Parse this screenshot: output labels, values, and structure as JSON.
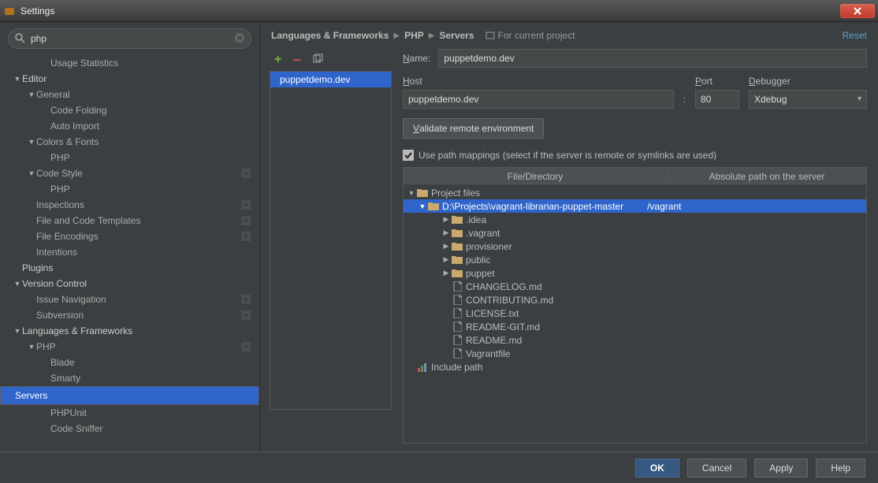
{
  "window": {
    "title": "Settings"
  },
  "search": {
    "value": "php"
  },
  "sidebar": {
    "items": [
      {
        "label": "Usage Statistics",
        "indent": 2,
        "arrow": ""
      },
      {
        "label": "Editor",
        "indent": 0,
        "arrow": "▼",
        "head": true
      },
      {
        "label": "General",
        "indent": 1,
        "arrow": "▼"
      },
      {
        "label": "Code Folding",
        "indent": 2,
        "arrow": ""
      },
      {
        "label": "Auto Import",
        "indent": 2,
        "arrow": ""
      },
      {
        "label": "Colors & Fonts",
        "indent": 1,
        "arrow": "▼"
      },
      {
        "label": "PHP",
        "indent": 2,
        "arrow": ""
      },
      {
        "label": "Code Style",
        "indent": 1,
        "arrow": "▼",
        "cfg": true
      },
      {
        "label": "PHP",
        "indent": 2,
        "arrow": ""
      },
      {
        "label": "Inspections",
        "indent": 1,
        "arrow": "",
        "cfg": true
      },
      {
        "label": "File and Code Templates",
        "indent": 1,
        "arrow": "",
        "cfg": true
      },
      {
        "label": "File Encodings",
        "indent": 1,
        "arrow": "",
        "cfg": true
      },
      {
        "label": "Intentions",
        "indent": 1,
        "arrow": ""
      },
      {
        "label": "Plugins",
        "indent": 0,
        "arrow": "",
        "head": true
      },
      {
        "label": "Version Control",
        "indent": 0,
        "arrow": "▼",
        "head": true
      },
      {
        "label": "Issue Navigation",
        "indent": 1,
        "arrow": "",
        "cfg": true
      },
      {
        "label": "Subversion",
        "indent": 1,
        "arrow": "",
        "cfg": true
      },
      {
        "label": "Languages & Frameworks",
        "indent": 0,
        "arrow": "▼",
        "head": true
      },
      {
        "label": "PHP",
        "indent": 1,
        "arrow": "▼",
        "cfg": true
      },
      {
        "label": "Blade",
        "indent": 2,
        "arrow": ""
      },
      {
        "label": "Smarty",
        "indent": 2,
        "arrow": ""
      },
      {
        "label": "Servers",
        "indent": 2,
        "arrow": "",
        "selected": true
      },
      {
        "label": "PHPUnit",
        "indent": 2,
        "arrow": ""
      },
      {
        "label": "Code Sniffer",
        "indent": 2,
        "arrow": ""
      }
    ]
  },
  "breadcrumb": {
    "a": "Languages & Frameworks",
    "b": "PHP",
    "c": "Servers",
    "proj": "For current project",
    "reset": "Reset"
  },
  "servers": {
    "item": "puppetdemo.dev"
  },
  "form": {
    "name_label": "Name:",
    "name_value": "puppetdemo.dev",
    "host_label": "Host",
    "host_value": "puppetdemo.dev",
    "port_label": "Port",
    "port_value": "80",
    "dbg_label": "Debugger",
    "dbg_value": "Xdebug",
    "validate": "Validate remote environment",
    "mapchk": "Use path mappings (select if the server is remote or symlinks are used)",
    "col1": "File/Directory",
    "col2": "Absolute path on the server"
  },
  "tree": {
    "root": "Project files",
    "proj_path": "D:\\Projects\\vagrant-librarian-puppet-master",
    "proj_map": "/vagrant",
    "folders": [
      ".idea",
      ".vagrant",
      "provisioner",
      "public",
      "puppet"
    ],
    "files": [
      "CHANGELOG.md",
      "CONTRIBUTING.md",
      "LICENSE.txt",
      "README-GIT.md",
      "README.md",
      "Vagrantfile"
    ],
    "include": "Include path"
  },
  "footer": {
    "ok": "OK",
    "cancel": "Cancel",
    "apply": "Apply",
    "help": "Help"
  }
}
